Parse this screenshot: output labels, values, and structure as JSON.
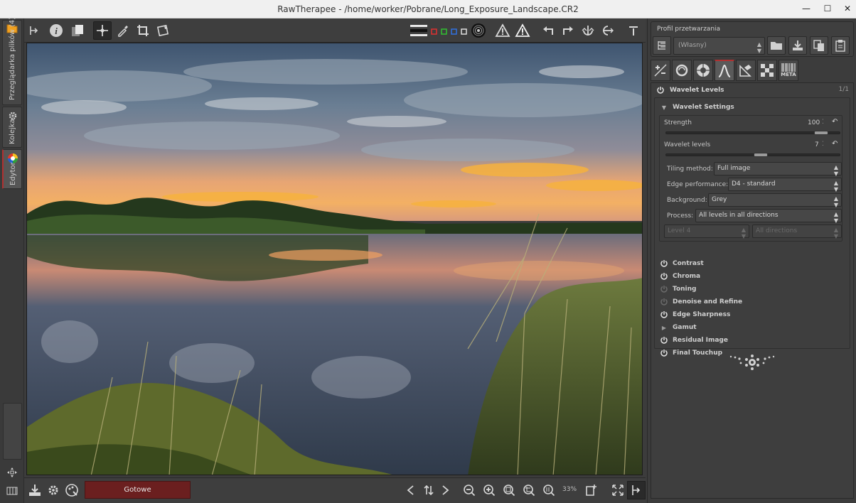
{
  "window": {
    "title": "RawTherapee  - /home/worker/Pobrane/Long_Exposure_Landscape.CR2",
    "min_glyph": "—",
    "max_glyph": "☐",
    "close_glyph": "✕"
  },
  "left_tabs": [
    {
      "label": "Przeglądarka plików (4)",
      "icon": "folder-icon"
    },
    {
      "label": "Kolejka",
      "icon": "gears-icon"
    },
    {
      "label": "Edytor",
      "icon": "color-wheel-icon"
    }
  ],
  "toolbar": {
    "icons": [
      "hide-history-icon",
      "info-icon",
      "before-after-icon",
      "hand-tool-icon",
      "color-picker-icon",
      "crop-icon",
      "straighten-icon",
      "preview-mode-icon",
      "rgb-channels-icon",
      "focus-mask-icon",
      "underexposure-warning-icon",
      "overexposure-warning-icon",
      "rotate-left-icon",
      "rotate-right-icon",
      "flip-vertical-icon",
      "flip-horizontal-icon",
      "hide-toolbar-icon"
    ]
  },
  "statusbar": {
    "progress_label": "Gotowe",
    "zoom": "33%",
    "icons": [
      "save-icon",
      "queue-icon",
      "external-editor-icon",
      "prev-image-icon",
      "sync-icon",
      "next-image-icon",
      "zoom-out-icon",
      "zoom-in-icon",
      "zoom-fit-icon",
      "zoom-fit-crop-icon",
      "zoom-100-icon",
      "new-detail-window-icon",
      "fullscreen-icon",
      "hide-panel-icon"
    ]
  },
  "profile": {
    "title": "Profil przetwarzania",
    "selected": "(Własny)",
    "buttons": [
      "open-profile-icon",
      "save-profile-icon",
      "copy-profile-icon",
      "paste-profile-icon"
    ]
  },
  "tool_tabs": [
    {
      "name": "exposure-tab",
      "label": ""
    },
    {
      "name": "detail-tab",
      "label": ""
    },
    {
      "name": "color-tab",
      "label": ""
    },
    {
      "name": "advanced-tab",
      "label": ""
    },
    {
      "name": "transform-tab",
      "label": ""
    },
    {
      "name": "raw-tab",
      "label": ""
    },
    {
      "name": "metadata-tab",
      "label": "META"
    }
  ],
  "wavelet": {
    "title": "Wavelet Levels",
    "page_indicator": "1/1",
    "settings_title": "Wavelet Settings",
    "strength": {
      "label": "Strength",
      "value": "100",
      "fraction": 0.93
    },
    "levels": {
      "label": "Wavelet levels",
      "value": "7",
      "fraction": 0.55
    },
    "combos": [
      {
        "label": "Tiling method:",
        "value": "Full image"
      },
      {
        "label": "Edge performance:",
        "value": "D4 - standard"
      },
      {
        "label": "Background:",
        "value": "Grey"
      },
      {
        "label": "Process:",
        "value": "All levels in all directions"
      }
    ],
    "disabled_combos": [
      "Level 4",
      "All directions"
    ],
    "subtools": [
      {
        "label": "Contrast",
        "enabled": true
      },
      {
        "label": "Chroma",
        "enabled": true
      },
      {
        "label": "Toning",
        "enabled": false
      },
      {
        "label": "Denoise and Refine",
        "enabled": false
      },
      {
        "label": "Edge Sharpness",
        "enabled": true
      },
      {
        "label": "Gamut",
        "enabled": null
      },
      {
        "label": "Residual Image",
        "enabled": true
      },
      {
        "label": "Final Touchup",
        "enabled": true
      }
    ]
  },
  "colors": {
    "accent": "#b03030",
    "progress": "#6b1f1f"
  }
}
